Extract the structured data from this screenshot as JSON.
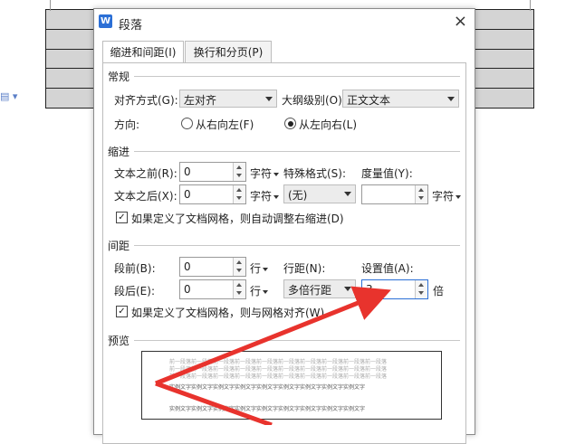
{
  "dialog": {
    "title": "段落",
    "app_icon_letter": "W",
    "close_glyph": "×"
  },
  "tabs": [
    {
      "label": "缩进和间距(I)",
      "active": true
    },
    {
      "label": "换行和分页(P)",
      "active": false
    }
  ],
  "general": {
    "section_label": "常规",
    "align_label": "对齐方式(G):",
    "align_value": "左对齐",
    "outline_label": "大纲级别(O):",
    "outline_value": "正文文本",
    "direction_label": "方向:",
    "rtl_label": "从右向左(F)",
    "ltr_label": "从左向右(L)",
    "selected_direction": "ltr"
  },
  "indent": {
    "section_label": "缩进",
    "before_label": "文本之前(R):",
    "before_value": "0",
    "before_unit": "字符",
    "after_label": "文本之后(X):",
    "after_value": "0",
    "after_unit": "字符",
    "special_label": "特殊格式(S):",
    "special_value": "(无)",
    "measure_label": "度量值(Y):",
    "measure_value": "",
    "measure_unit": "字符",
    "grid_checkbox_label": "如果定义了文档网格，则自动调整右缩进(D)",
    "grid_checked": true
  },
  "spacing": {
    "section_label": "间距",
    "before_label": "段前(B):",
    "before_value": "0",
    "before_unit": "行",
    "after_label": "段后(E):",
    "after_value": "0",
    "after_unit": "行",
    "line_label": "行距(N):",
    "line_value": "多倍行距",
    "setting_label": "设置值(A):",
    "setting_value": "3",
    "setting_unit": "倍",
    "grid_checkbox_label": "如果定义了文档网格，则与网格对齐(W)",
    "grid_checked": true
  },
  "preview": {
    "section_label": "预览",
    "prev_line": "前一段落前一段落前一段落前一段落前一段落前一段落前一段落前一段落前一段落前一段落",
    "sample_line": "实例文字实例文字实例文字实例文字实例文字实例文字实例文字实例文字实例文字"
  },
  "colors": {
    "accent": "#2b6fd6",
    "arrow": "#e8332d",
    "table_fill": "#d4d4d4"
  }
}
